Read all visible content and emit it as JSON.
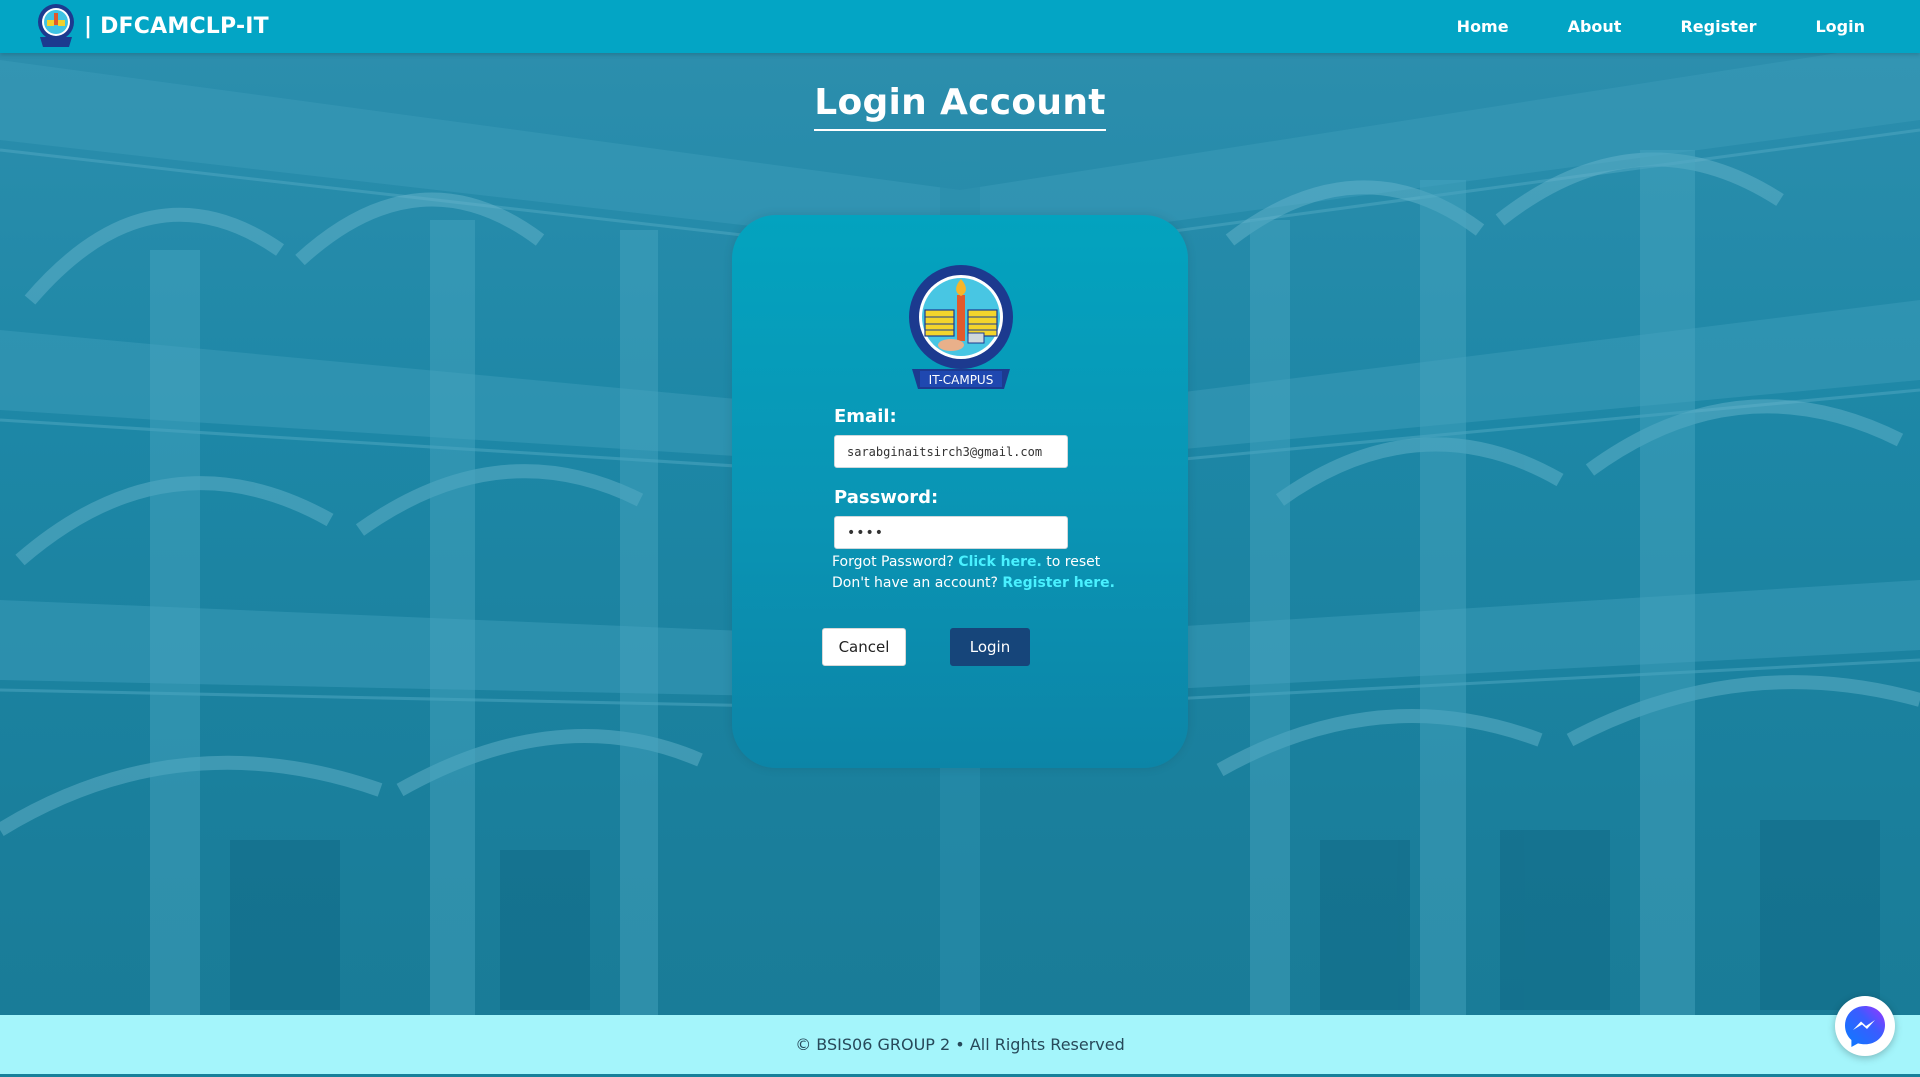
{
  "navbar": {
    "brand_text": "| DFCAMCLP-IT",
    "logo_icon": "school-seal-icon",
    "links": [
      {
        "label": "Home"
      },
      {
        "label": "About"
      },
      {
        "label": "Register"
      },
      {
        "label": "Login"
      }
    ]
  },
  "page": {
    "title": "Login Account"
  },
  "login_card": {
    "logo_icon": "school-seal-icon",
    "logo_caption": "IT-CAMPUS",
    "email_label": "Email:",
    "email_value": "sarabginaitsirch3@gmail.com",
    "password_label": "Password:",
    "password_value": "••••",
    "forgot_prefix": "Forgot Password?",
    "forgot_link": "Click here.",
    "forgot_suffix": "to reset",
    "register_prefix": "Don't have an account?",
    "register_link": "Register here.",
    "cancel_label": "Cancel",
    "login_label": "Login"
  },
  "footer": {
    "text": "© BSIS06 GROUP 2 • All Rights Reserved"
  },
  "chat": {
    "icon": "messenger-icon"
  },
  "colors": {
    "navbar": "#03a5c5",
    "card": "#0a94b4",
    "link_accent": "#49f1ff",
    "login_button": "#16457a",
    "footer": "#a4f5fb"
  }
}
